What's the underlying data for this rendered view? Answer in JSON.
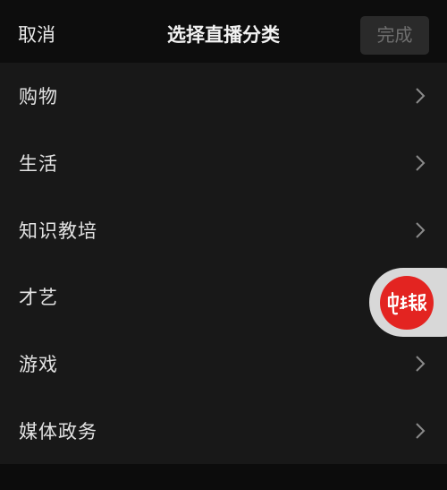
{
  "header": {
    "cancel_label": "取消",
    "title": "选择直播分类",
    "done_label": "完成"
  },
  "categories": [
    {
      "label": "购物"
    },
    {
      "label": "生活"
    },
    {
      "label": "知识教培"
    },
    {
      "label": "才艺"
    },
    {
      "label": "游戏"
    },
    {
      "label": "媒体政务"
    }
  ],
  "floating_widget": {
    "logo_text": "电脑报",
    "logo_color": "#e32421"
  },
  "colors": {
    "background": "#0c0c0c",
    "list_background": "#181818",
    "text": "#e2e2e2",
    "done_disabled": "#6e6e6e"
  }
}
